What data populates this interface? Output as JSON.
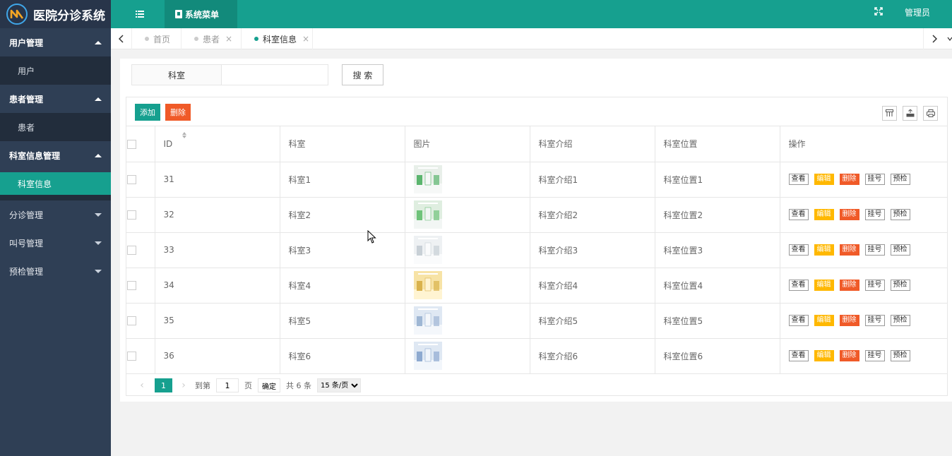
{
  "app": {
    "title": "医院分诊系统",
    "user": "管理员",
    "menu_label": "系统菜单"
  },
  "sidebar": {
    "groups": [
      {
        "label": "用户管理",
        "open": true,
        "items": [
          "用户"
        ]
      },
      {
        "label": "患者管理",
        "open": true,
        "items": [
          "患者"
        ]
      },
      {
        "label": "科室信息管理",
        "open": true,
        "items": [
          "科室信息"
        ]
      },
      {
        "label": "分诊管理",
        "open": false,
        "items": []
      },
      {
        "label": "叫号管理",
        "open": false,
        "items": []
      },
      {
        "label": "预检管理",
        "open": false,
        "items": []
      }
    ],
    "active_item": "科室信息"
  },
  "tabs": [
    {
      "label": "首页",
      "closable": false,
      "active": false
    },
    {
      "label": "患者",
      "closable": true,
      "active": false
    },
    {
      "label": "科室信息",
      "closable": true,
      "active": true
    }
  ],
  "search": {
    "label": "科室",
    "value": "",
    "placeholder": "",
    "button": "搜 索"
  },
  "toolbar": {
    "add": "添加",
    "delete": "删除"
  },
  "table": {
    "columns": [
      "ID",
      "科室",
      "图片",
      "科室介绍",
      "科室位置",
      "操作"
    ],
    "rows": [
      {
        "id": "31",
        "name": "科室1",
        "intro": "科室介绍1",
        "location": "科室位置1"
      },
      {
        "id": "32",
        "name": "科室2",
        "intro": "科室介绍2",
        "location": "科室位置2"
      },
      {
        "id": "33",
        "name": "科室3",
        "intro": "科室介绍3",
        "location": "科室位置3"
      },
      {
        "id": "34",
        "name": "科室4",
        "intro": "科室介绍4",
        "location": "科室位置4"
      },
      {
        "id": "35",
        "name": "科室5",
        "intro": "科室介绍5",
        "location": "科室位置5"
      },
      {
        "id": "36",
        "name": "科室6",
        "intro": "科室介绍6",
        "location": "科室位置6"
      }
    ],
    "actions": [
      "查看",
      "编辑",
      "删除",
      "挂号",
      "预检"
    ]
  },
  "pager": {
    "current": "1",
    "goto_label": "到第",
    "goto_value": "1",
    "page_unit": "页",
    "ok": "确定",
    "total": "共 6 条",
    "page_size": "15 条/页"
  },
  "colors": {
    "accent": "#16a08f",
    "sidebar": "#2f3f55",
    "danger": "#f05a28",
    "warn": "#ffb800"
  }
}
